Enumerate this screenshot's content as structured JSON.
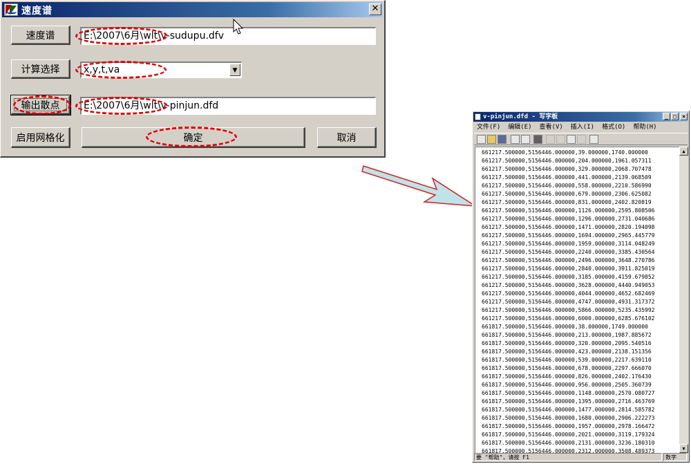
{
  "dialog": {
    "title": "速度谱",
    "close_glyph": "✕",
    "buttons": {
      "velocity_spectrum": "速度谱",
      "compute_select": "计算选择",
      "output_points": "输出散点",
      "enable_grid": "启用网格化",
      "ok": "确定",
      "cancel": "取消"
    },
    "fields": {
      "velocity_file": "E:\\2007\\6月\\wlt\\v-sudupu.dfv",
      "compute_select_value": "x,y,t,va",
      "output_file": "E:\\2007\\6月\\wlt\\v-pinjun.dfd"
    },
    "combo_arrow": "▼",
    "annotation_color": "#e00000"
  },
  "wordpad": {
    "title": "v-pinjun.dfd - 写字板",
    "controls": {
      "minimize": "_",
      "maximize": "□",
      "close": "×"
    },
    "menu": [
      "文件(F)",
      "编辑(E)",
      "查看(V)",
      "插入(I)",
      "格式(O)",
      "帮助(H)"
    ],
    "scroll_up": "▲",
    "scroll_down": "▼",
    "lines": [
      "661217.500000,5156446.000000,39.000000,1740.000000",
      "661217.500000,5156446.000000,204.000000,1961.057311",
      "661217.500000,5156446.000000,329.000000,2068.707478",
      "661217.500000,5156446.000000,441.000000,2139.068509",
      "661217.500000,5156446.000000,558.000000,2210.586990",
      "661217.500000,5156446.000000,679.000000,2306.625082",
      "661217.500000,5156446.000000,831.000000,2402.820819",
      "661217.500000,5156446.000000,1126.000000,2595.808506",
      "661217.500000,5156446.000000,1296.000000,2731.040686",
      "661217.500000,5156446.000000,1471.000000,2820.194098",
      "661217.500000,5156446.000000,1694.000000,2965.445779",
      "661217.500000,5156446.000000,1959.000000,3114.048249",
      "661217.500000,5156446.000000,2240.000000,3385.430564",
      "661217.500000,5156446.000000,2496.000000,3648.270786",
      "661217.500000,5156446.000000,2840.000000,3911.825019",
      "661217.500000,5156446.000000,3185.000000,4159.679852",
      "661217.500000,5156446.000000,3628.000000,4440.949053",
      "661217.500000,5156446.000000,4044.000000,4652.682469",
      "661217.500000,5156446.000000,4747.000000,4931.317372",
      "661217.500000,5156446.000000,5866.000000,5235.435992",
      "661217.500000,5156446.000000,6000.000000,6285.676102",
      "661817.500000,5156446.000000,38.000000,1749.000000",
      "661817.500000,5156446.000000,213.000000,1987.885672",
      "661817.500000,5156446.000000,320.000000,2095.540516",
      "661817.500000,5156446.000000,423.000000,2138.151356",
      "661817.500000,5156446.000000,539.000000,2217.639110",
      "661817.500000,5156446.000000,678.000000,2297.666070",
      "661817.500000,5156446.000000,826.000000,2402.176430",
      "661817.500000,5156446.000000,956.000000,2505.360739",
      "661817.500000,5156446.000000,1148.000000,2570.080727",
      "661817.500000,5156446.000000,1395.000000,2716.463769",
      "661817.500000,5156446.000000,1477.000000,2814.585782",
      "661817.500000,5156446.000000,1680.000000,2906.222273",
      "661817.500000,5156446.000000,1957.000000,2978.166472",
      "661817.500000,5156446.000000,2021.000000,3119.179324",
      "661817.500000,5156446.000000,2131.000000,3236.180310",
      "661817.500000,5156446.000000,2312.000000,3508.489373"
    ],
    "status": {
      "hint": "要 \"帮助\"，请按 F1",
      "mode": "数字"
    }
  }
}
